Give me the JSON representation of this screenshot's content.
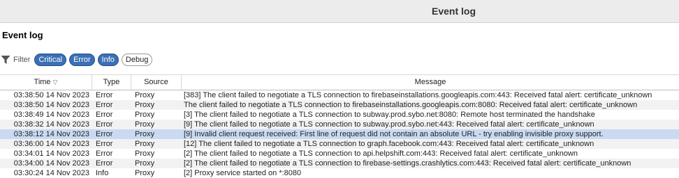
{
  "window": {
    "title": "Event log"
  },
  "panel": {
    "title": "Event log"
  },
  "filter": {
    "label": "Filter",
    "chips": [
      {
        "label": "Critical",
        "active": true
      },
      {
        "label": "Error",
        "active": true
      },
      {
        "label": "Info",
        "active": true
      },
      {
        "label": "Debug",
        "active": false
      }
    ]
  },
  "columns": {
    "time": "Time",
    "type": "Type",
    "source": "Source",
    "message": "Message"
  },
  "rows": [
    {
      "time": "03:38:50 14 Nov 2023",
      "type": "Error",
      "source": "Proxy",
      "message": "[383]  The client failed to negotiate a TLS connection to firebaseinstallations.googleapis.com:443: Received fatal alert: certificate_unknown"
    },
    {
      "time": "03:38:50 14 Nov 2023",
      "type": "Error",
      "source": "Proxy",
      "message": "The client failed to negotiate a TLS connection to firebaseinstallations.googleapis.com:8080: Received fatal alert: certificate_unknown"
    },
    {
      "time": "03:38:49 14 Nov 2023",
      "type": "Error",
      "source": "Proxy",
      "message": "[3]  The client failed to negotiate a TLS connection to subway.prod.sybo.net:8080: Remote host terminated the handshake"
    },
    {
      "time": "03:38:32 14 Nov 2023",
      "type": "Error",
      "source": "Proxy",
      "message": "[9]  The client failed to negotiate a TLS connection to subway.prod.sybo.net:443: Received fatal alert: certificate_unknown"
    },
    {
      "time": "03:38:12 14 Nov 2023",
      "type": "Error",
      "source": "Proxy",
      "message": "[9]  Invalid client request received: First line of request did not contain an absolute URL - try enabling invisible proxy support."
    },
    {
      "time": "03:36:00 14 Nov 2023",
      "type": "Error",
      "source": "Proxy",
      "message": "[12]  The client failed to negotiate a TLS connection to graph.facebook.com:443: Received fatal alert: certificate_unknown"
    },
    {
      "time": "03:34:01 14 Nov 2023",
      "type": "Error",
      "source": "Proxy",
      "message": "[2]  The client failed to negotiate a TLS connection to api.helpshift.com:443: Received fatal alert: certificate_unknown"
    },
    {
      "time": "03:34:00 14 Nov 2023",
      "type": "Error",
      "source": "Proxy",
      "message": "[2]  The client failed to negotiate a TLS connection to firebase-settings.crashlytics.com:443: Received fatal alert: certificate_unknown"
    },
    {
      "time": "03:30:24 14 Nov 2023",
      "type": "Info",
      "source": "Proxy",
      "message": "[2]  Proxy service started on *:8080"
    }
  ],
  "selected_row": 4
}
